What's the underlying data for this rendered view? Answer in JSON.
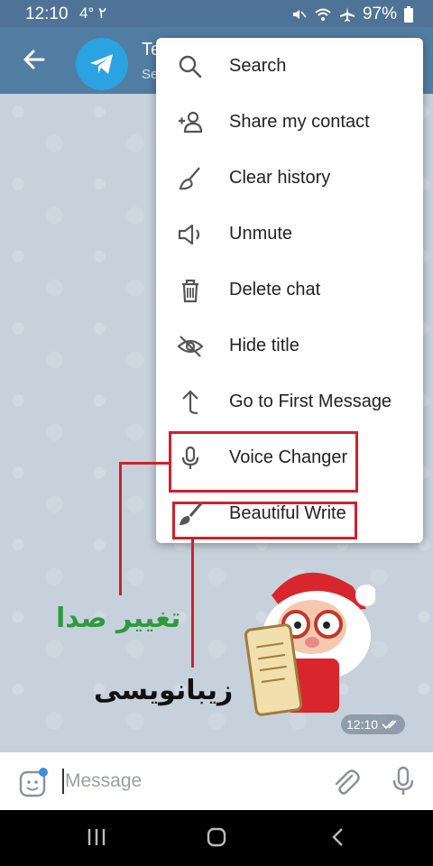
{
  "status_bar": {
    "time": "12:10",
    "extra": "4° ٢",
    "battery": "97%"
  },
  "header": {
    "title": "Te",
    "subtitle": "Se"
  },
  "menu": {
    "items": [
      {
        "label": "Search",
        "icon": "search-icon"
      },
      {
        "label": "Share my contact",
        "icon": "add-person-icon"
      },
      {
        "label": "Clear history",
        "icon": "broom-icon"
      },
      {
        "label": "Unmute",
        "icon": "speaker-icon"
      },
      {
        "label": "Delete chat",
        "icon": "trash-icon"
      },
      {
        "label": "Hide title",
        "icon": "eye-off-icon"
      },
      {
        "label": "Go to First Message",
        "icon": "arrow-up-icon"
      },
      {
        "label": "Voice Changer",
        "icon": "microphone-icon"
      },
      {
        "label": "Beautiful Write",
        "icon": "brush-icon"
      }
    ]
  },
  "annotations": {
    "voice_changer_fa": "تغییر صدا",
    "beautiful_write_fa": "زیبانویسی"
  },
  "message": {
    "time": "12:10"
  },
  "input": {
    "placeholder": "Message"
  },
  "colors": {
    "header": "#527da3",
    "accent": "#2aa3e0",
    "highlight": "#d0202c"
  }
}
